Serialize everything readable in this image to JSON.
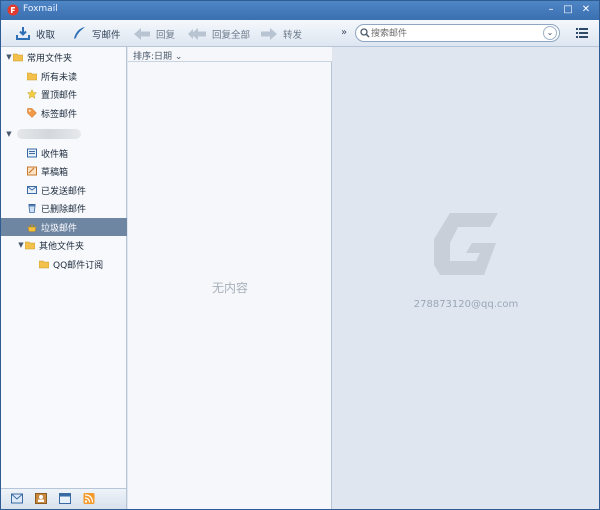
{
  "window": {
    "title": "Foxmail"
  },
  "toolbar": {
    "receive_label": "收取",
    "compose_label": "写邮件",
    "reply_label": "回复",
    "reply_all_label": "回复全部",
    "forward_label": "转发",
    "overflow_glyph": "»"
  },
  "search": {
    "placeholder": "搜索邮件",
    "value": ""
  },
  "sidebar": {
    "common_folder": "常用文件夹",
    "items": [
      {
        "label": "所有未读",
        "icon": "folder-icon"
      },
      {
        "label": "置顶邮件",
        "icon": "star-icon"
      },
      {
        "label": "标签邮件",
        "icon": "tag-icon"
      }
    ],
    "account_folders": [
      {
        "label": "收件箱",
        "icon": "inbox-icon"
      },
      {
        "label": "草稿箱",
        "icon": "draft-icon"
      },
      {
        "label": "已发送邮件",
        "icon": "sent-icon"
      },
      {
        "label": "已删除邮件",
        "icon": "trash-icon"
      },
      {
        "label": "垃圾邮件",
        "icon": "spam-icon",
        "selected": true
      }
    ],
    "other_folder": "其他文件夹",
    "sub_items": [
      {
        "label": "QQ邮件订阅",
        "icon": "folder-icon"
      }
    ]
  },
  "list": {
    "sort_label": "排序:日期",
    "empty_text": "无内容"
  },
  "reader": {
    "account_email": "278873120@qq.com"
  },
  "colors": {
    "accent": "#3a6fb0",
    "selected_row": "#6f86a3",
    "logo": "#c8cfd8"
  }
}
